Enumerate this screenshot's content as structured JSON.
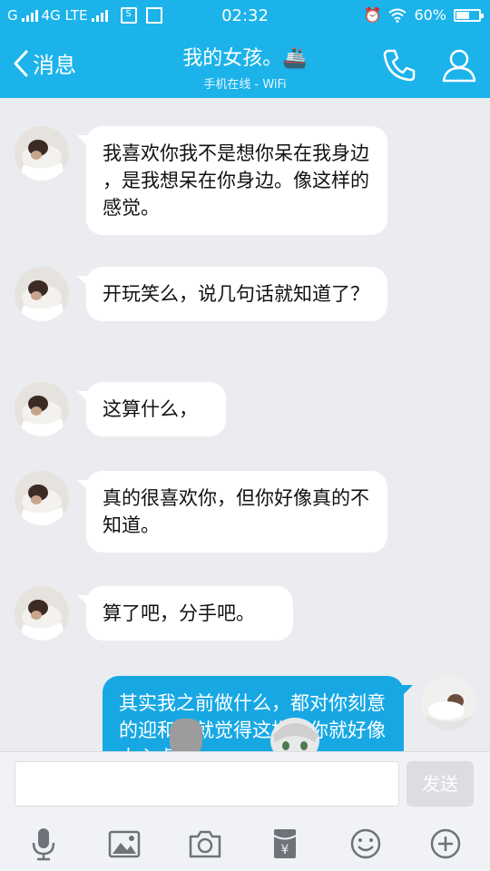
{
  "status_bar": {
    "carrier_left": "G",
    "network": "4G LTE",
    "time": "02:32",
    "battery": "60%",
    "battery_level": 0.6
  },
  "header": {
    "back_label": "消息",
    "title": "我的女孩。🚢",
    "subtitle": "手机在线 - WiFi"
  },
  "messages": [
    {
      "from": "other",
      "text": "我喜欢你我不是想你呆在我身边 ，是我想呆在你身边。像这样的感觉。"
    },
    {
      "from": "other",
      "text": "开玩笑么，说几句话就知道了？"
    },
    {
      "from": "other",
      "text": "这算什么，"
    },
    {
      "from": "other",
      "text": "真的很喜欢你，但你好像真的不知道。"
    },
    {
      "from": "other",
      "text": "算了吧，分手吧。"
    },
    {
      "from": "self",
      "text": "其实我之前做什么，都对你刻意的迎和，就觉得这样对你就好像太心虚了"
    }
  ],
  "input_bar": {
    "message_value": "",
    "send_label": "发送"
  },
  "toolbar": {
    "icons": [
      "microphone-icon",
      "image-icon",
      "camera-icon",
      "red-packet-icon",
      "emoji-icon",
      "plus-icon"
    ]
  },
  "colors": {
    "accent": "#1bb3ea",
    "self_bubble": "#17a8e4",
    "other_bubble": "#ffffff",
    "background": "#ebecf0"
  }
}
